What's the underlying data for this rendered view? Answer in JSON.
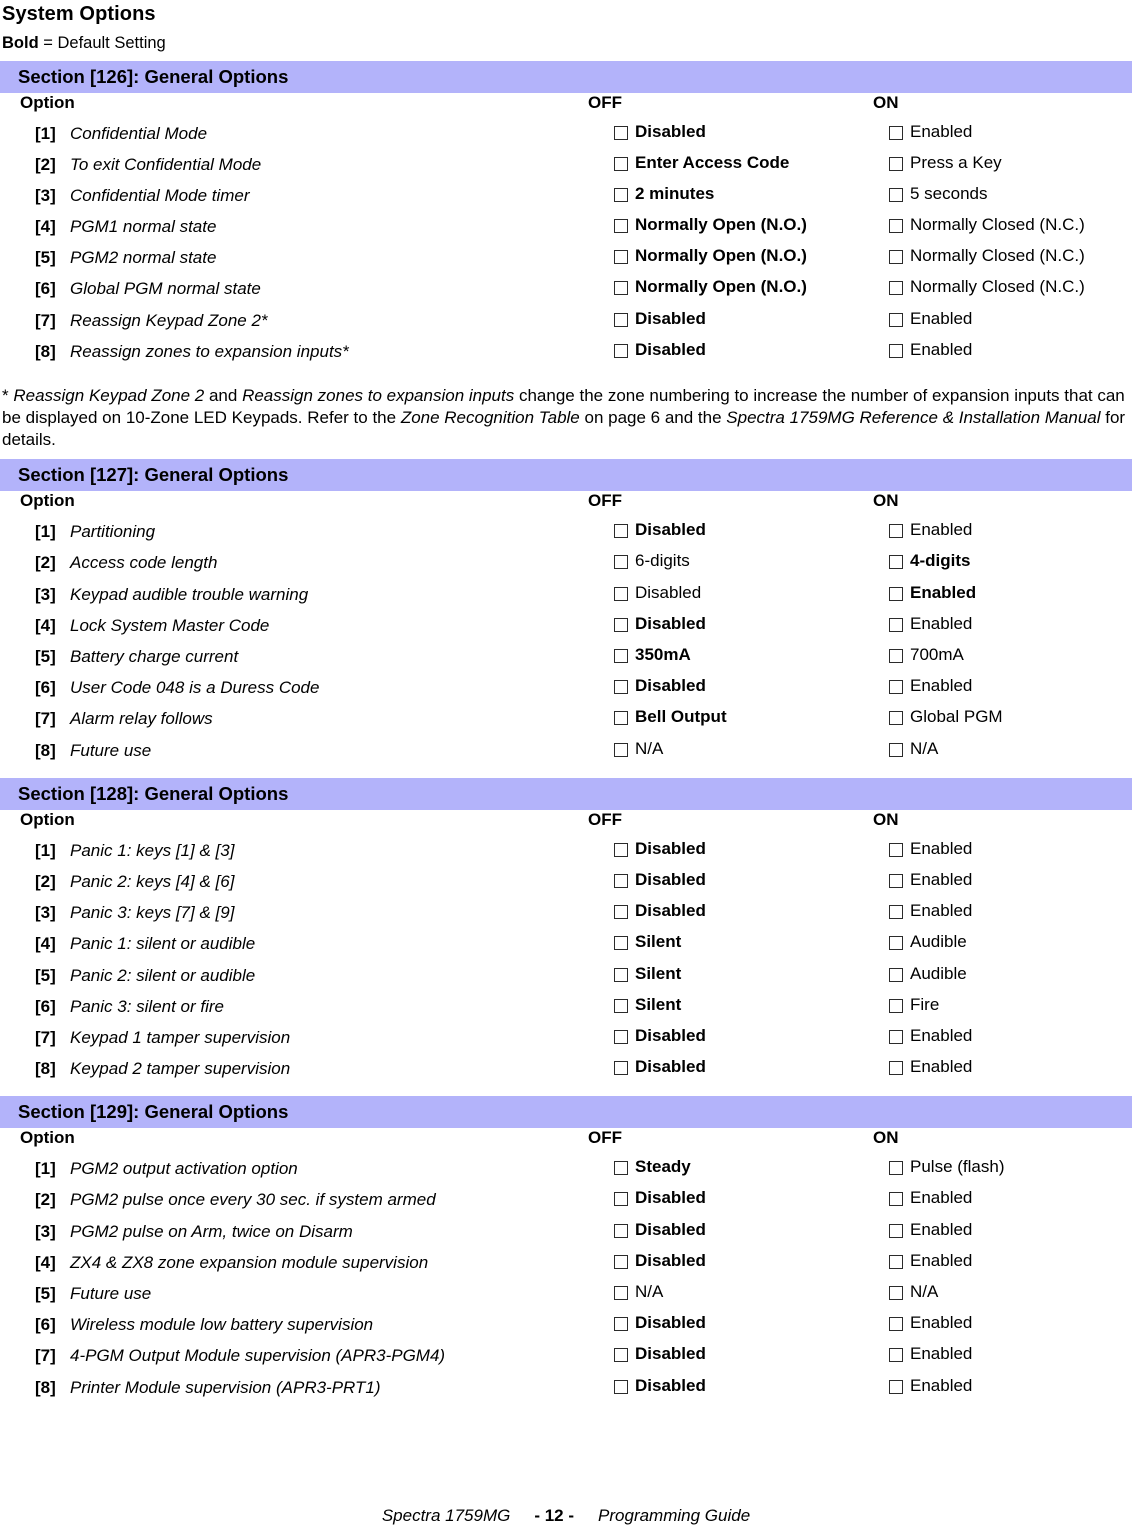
{
  "document": {
    "title": "System Options",
    "legend_bold": "Bold",
    "legend_rest": " = Default Setting"
  },
  "column_headers": {
    "option": "Option",
    "off": "OFF",
    "on": "ON"
  },
  "footnote": {
    "star": "* ",
    "part1_italic": "Reassign Keypad Zone 2",
    "part2": " and ",
    "part3_italic": "Reassign zones to expansion inputs",
    "part4": " change the zone numbering to increase the number of expansion inputs that can be displayed on 10-Zone LED Keypads. Refer to the ",
    "part5_italic": "Zone Recognition Table",
    "part6": " on page 6 and the ",
    "part7_italic": "Spectra 1759MG Reference & Installation Manual",
    "part8": " for details."
  },
  "footer": {
    "manual": "Spectra 1759MG",
    "page": "- 12 -",
    "guide": "Programming Guide"
  },
  "sections": [
    {
      "header": "Section [126]: General Options",
      "rows": [
        {
          "num": "[1]",
          "label": "Confidential Mode",
          "off": "Disabled",
          "off_bold": true,
          "on": "Enabled",
          "on_bold": false
        },
        {
          "num": "[2]",
          "label": "To exit Confidential Mode",
          "off": "Enter Access Code",
          "off_bold": true,
          "on": "Press a Key",
          "on_bold": false
        },
        {
          "num": "[3]",
          "label": "Confidential Mode timer",
          "off": "2 minutes",
          "off_bold": true,
          "on": "5 seconds",
          "on_bold": false
        },
        {
          "num": "[4]",
          "label": "PGM1 normal state",
          "off": "Normally Open (N.O.)",
          "off_bold": true,
          "on": "Normally Closed (N.C.)",
          "on_bold": false
        },
        {
          "num": "[5]",
          "label": "PGM2 normal state",
          "off": "Normally Open (N.O.)",
          "off_bold": true,
          "on": "Normally Closed (N.C.)",
          "on_bold": false
        },
        {
          "num": "[6]",
          "label": "Global PGM normal state",
          "off": "Normally Open (N.O.)",
          "off_bold": true,
          "on": "Normally Closed (N.C.)",
          "on_bold": false
        },
        {
          "num": "[7]",
          "label": "Reassign Keypad Zone 2*",
          "off": "Disabled",
          "off_bold": true,
          "on": "Enabled",
          "on_bold": false
        },
        {
          "num": "[8]",
          "label": "Reassign zones to expansion inputs*",
          "off": "Disabled",
          "off_bold": true,
          "on": "Enabled",
          "on_bold": false
        }
      ]
    },
    {
      "header": "Section [127]: General Options",
      "rows": [
        {
          "num": "[1]",
          "label": "Partitioning",
          "off": "Disabled",
          "off_bold": true,
          "on": "Enabled",
          "on_bold": false
        },
        {
          "num": "[2]",
          "label": "Access code length",
          "off": "6-digits",
          "off_bold": false,
          "on": "4-digits",
          "on_bold": true
        },
        {
          "num": "[3]",
          "label": "Keypad audible trouble warning",
          "off": "Disabled",
          "off_bold": false,
          "on": "Enabled",
          "on_bold": true
        },
        {
          "num": "[4]",
          "label": "Lock System Master Code",
          "off": "Disabled",
          "off_bold": true,
          "on": "Enabled",
          "on_bold": false
        },
        {
          "num": "[5]",
          "label": "Battery charge current",
          "off": "350mA",
          "off_bold": true,
          "on": "700mA",
          "on_bold": false
        },
        {
          "num": "[6]",
          "label": "User Code 048 is a Duress Code",
          "off": "Disabled",
          "off_bold": true,
          "on": "Enabled",
          "on_bold": false
        },
        {
          "num": "[7]",
          "label": "Alarm relay follows",
          "off": "Bell Output",
          "off_bold": true,
          "on": "Global PGM",
          "on_bold": false
        },
        {
          "num": "[8]",
          "label": "Future use",
          "off": "N/A",
          "off_bold": false,
          "on": "N/A",
          "on_bold": false
        }
      ]
    },
    {
      "header": "Section [128]: General Options",
      "rows": [
        {
          "num": "[1]",
          "label": "Panic 1: keys [1] & [3]",
          "off": "Disabled",
          "off_bold": true,
          "on": "Enabled",
          "on_bold": false
        },
        {
          "num": "[2]",
          "label": "Panic 2: keys [4] & [6]",
          "off": "Disabled",
          "off_bold": true,
          "on": "Enabled",
          "on_bold": false
        },
        {
          "num": "[3]",
          "label": "Panic 3: keys [7] & [9]",
          "off": "Disabled",
          "off_bold": true,
          "on": "Enabled",
          "on_bold": false
        },
        {
          "num": "[4]",
          "label": "Panic 1: silent or audible",
          "off": "Silent",
          "off_bold": true,
          "on": "Audible",
          "on_bold": false
        },
        {
          "num": "[5]",
          "label": "Panic 2: silent or audible",
          "off": "Silent",
          "off_bold": true,
          "on": "Audible",
          "on_bold": false
        },
        {
          "num": "[6]",
          "label": "Panic 3: silent or fire",
          "off": "Silent",
          "off_bold": true,
          "on": "Fire",
          "on_bold": false
        },
        {
          "num": "[7]",
          "label": "Keypad 1 tamper supervision",
          "off": "Disabled",
          "off_bold": true,
          "on": "Enabled",
          "on_bold": false
        },
        {
          "num": "[8]",
          "label": "Keypad 2 tamper supervision",
          "off": "Disabled",
          "off_bold": true,
          "on": "Enabled",
          "on_bold": false
        }
      ]
    },
    {
      "header": "Section [129]: General Options",
      "rows": [
        {
          "num": "[1]",
          "label": "PGM2 output activation option",
          "off": "Steady",
          "off_bold": true,
          "on": "Pulse (flash)",
          "on_bold": false
        },
        {
          "num": "[2]",
          "label": "PGM2 pulse once every 30 sec. if system armed",
          "off": "Disabled",
          "off_bold": true,
          "on": "Enabled",
          "on_bold": false
        },
        {
          "num": "[3]",
          "label": "PGM2 pulse on Arm, twice on Disarm",
          "off": "Disabled",
          "off_bold": true,
          "on": "Enabled",
          "on_bold": false
        },
        {
          "num": "[4]",
          "label": "ZX4 & ZX8 zone expansion module supervision",
          "off": "Disabled",
          "off_bold": true,
          "on": "Enabled",
          "on_bold": false
        },
        {
          "num": "[5]",
          "label": "Future use",
          "off": "N/A",
          "off_bold": false,
          "on": "N/A",
          "on_bold": false
        },
        {
          "num": "[6]",
          "label": "Wireless module low battery supervision",
          "off": "Disabled",
          "off_bold": true,
          "on": "Enabled",
          "on_bold": false
        },
        {
          "num": "[7]",
          "label": "4-PGM Output Module supervision (APR3-PGM4)",
          "off": "Disabled",
          "off_bold": true,
          "on": "Enabled",
          "on_bold": false
        },
        {
          "num": "[8]",
          "label": "Printer Module supervision (APR3-PRT1)",
          "off": "Disabled",
          "off_bold": true,
          "on": "Enabled",
          "on_bold": false
        }
      ]
    }
  ]
}
